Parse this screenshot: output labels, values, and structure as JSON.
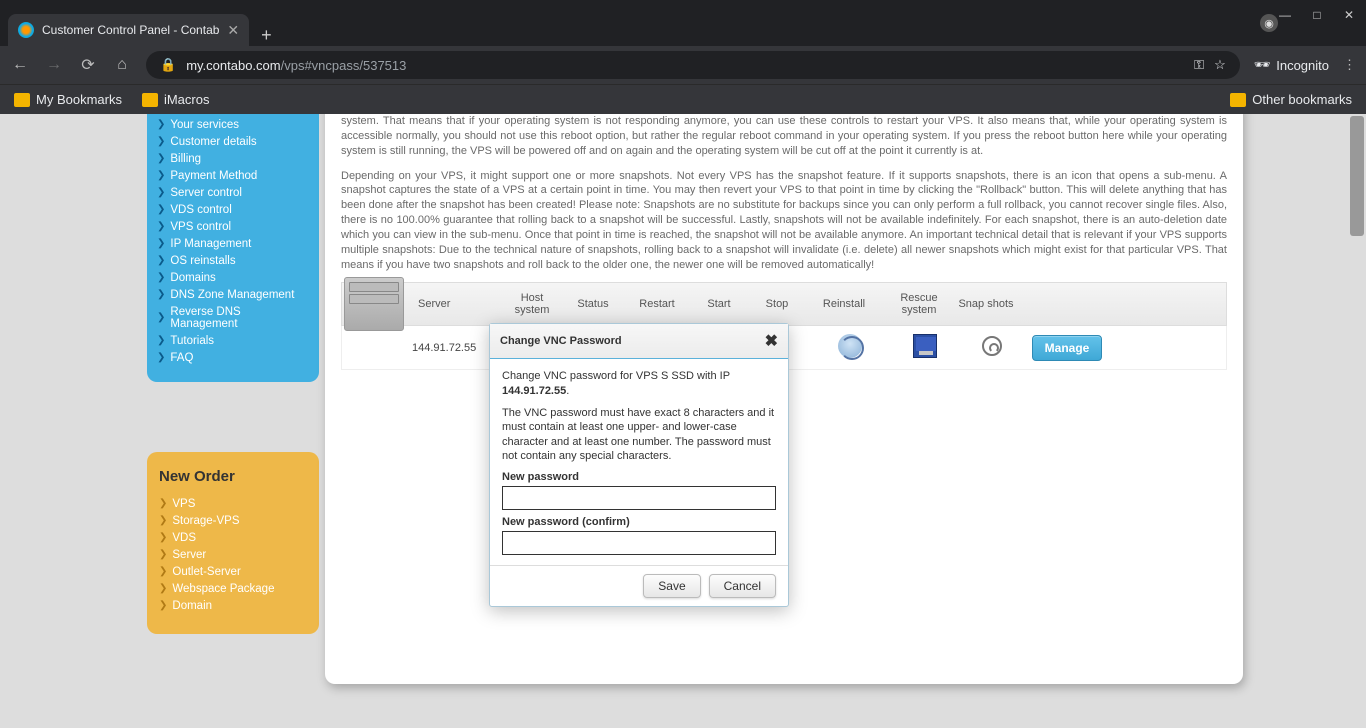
{
  "browser": {
    "tab_title": "Customer Control Panel - Contab",
    "url_host": "my.contabo.com",
    "url_path": "/vps#vncpass/537513",
    "incognito": "Incognito",
    "bookmarks": {
      "my": "My Bookmarks",
      "imacros": "iMacros",
      "other": "Other bookmarks"
    }
  },
  "sidebar": {
    "items": [
      "Your services",
      "Customer details",
      "Billing",
      "Payment Method",
      "Server control",
      "VDS control",
      "VPS control",
      "IP Management",
      "OS reinstalls",
      "Domains",
      "DNS Zone Management",
      "Reverse DNS Management",
      "Tutorials",
      "FAQ"
    ]
  },
  "neworder": {
    "title": "New Order",
    "items": [
      "VPS",
      "Storage-VPS",
      "VDS",
      "Server",
      "Outlet-Server",
      "Webspace Package",
      "Domain"
    ]
  },
  "main": {
    "desc1": "system. That means that if your operating system is not responding anymore, you can use these controls to restart your VPS. It also means that, while your operating system is accessible normally, you should not use this reboot option, but rather the regular reboot command in your operating system. If you press the reboot button here while your operating system is still running, the VPS will be powered off and on again and the operating system will be cut off at the point it currently is at.",
    "desc2": "Depending on your VPS, it might support one or more snapshots. Not every VPS has the snapshot feature. If it supports snapshots, there is an icon that opens a sub-menu. A snapshot captures the state of a VPS at a certain point in time. You may then revert your VPS to that point in time by clicking the \"Rollback\" button. This will delete anything that has been done after the snapshot has been created! Please note: Snapshots are no substitute for backups since you can only perform a full rollback, you cannot recover single files. Also, there is no 100.00% guarantee that rolling back to a snapshot will be successful. Lastly, snapshots will not be available indefinitely. For each snapshot, there is an auto-deletion date which you can view in the sub-menu. Once that point in time is reached, the snapshot will not be available anymore. An important technical detail that is relevant if your VPS supports multiple snapshots: Due to the technical nature of snapshots, rolling back to a snapshot will invalidate (i.e. delete) all newer snapshots which might exist for that particular VPS. That means if you have two snapshots and roll back to the older one, the newer one will be removed automatically!",
    "headers": {
      "server": "Server",
      "host": "Host system",
      "status": "Status",
      "restart": "Restart",
      "start": "Start",
      "stop": "Stop",
      "reinstall": "Reinstall",
      "rescue": "Rescue system",
      "snap": "Snap shots"
    },
    "row": {
      "ip": "144.91.72.55",
      "manage": "Manage"
    }
  },
  "dialog": {
    "title": "Change VNC Password",
    "line1a": "Change VNC password for VPS S SSD with IP ",
    "line1b": "144.91.72.55",
    "line2": "The VNC password must have exact 8 characters and it must contain at least one upper- and lower-case character and at least one number. The password must not contain any special characters.",
    "new_label": "New password",
    "confirm_label": "New password (confirm)",
    "save": "Save",
    "cancel": "Cancel"
  }
}
